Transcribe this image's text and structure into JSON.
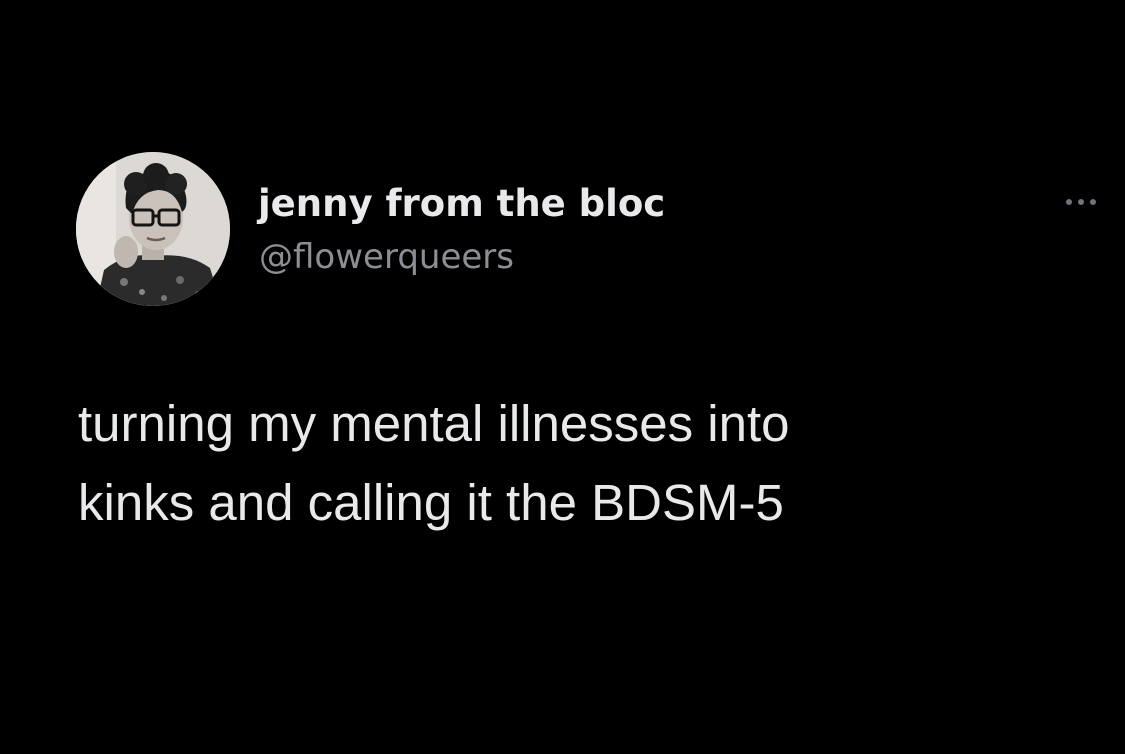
{
  "tweet": {
    "author": {
      "display_name": "jenny from the bloc",
      "handle": "@flowerqueers",
      "avatar_icon": "profile-photo-avatar"
    },
    "more_icon": "more-options-icon",
    "text_lines": [
      "turning my mental illnesses into",
      "kinks and calling it the BDSM-5"
    ]
  },
  "colors": {
    "background": "#000000",
    "primary_text": "#e7e9ea",
    "secondary_text": "#8b8f94"
  }
}
